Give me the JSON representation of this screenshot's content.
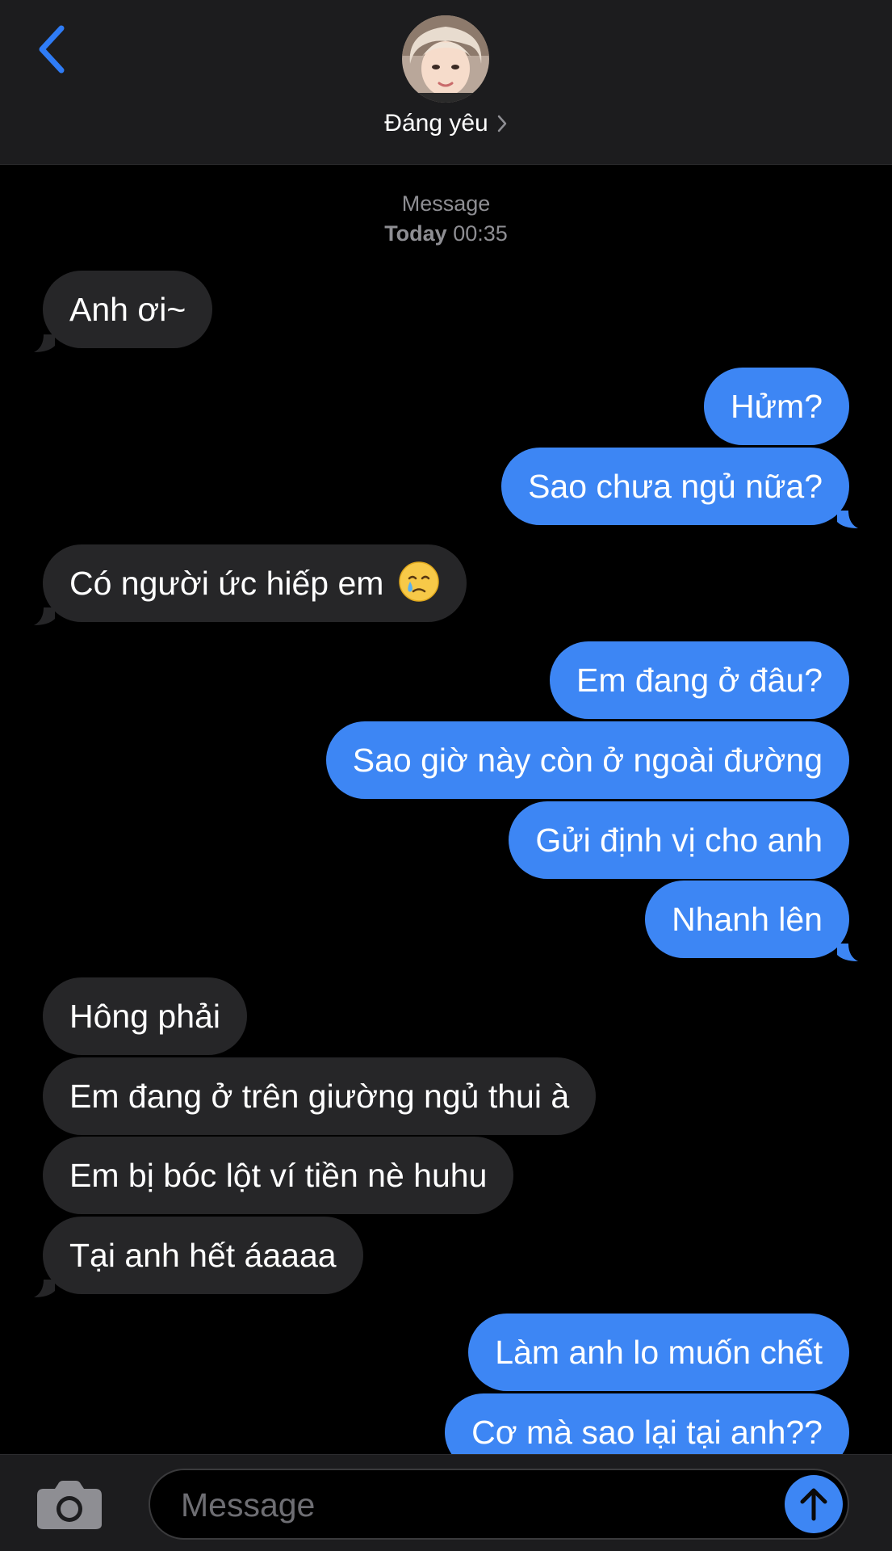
{
  "header": {
    "contact_name": "Đáng yêu"
  },
  "timestamp": {
    "service": "Message",
    "day": "Today",
    "time": "00:35"
  },
  "messages": [
    {
      "from": "them",
      "text": "Anh ơi~"
    },
    {
      "from": "me",
      "text": "Hửm?"
    },
    {
      "from": "me",
      "text": "Sao chưa ngủ nữa?"
    },
    {
      "from": "them",
      "text": "Có người ức hiếp em",
      "emoji": "crying-face"
    },
    {
      "from": "me",
      "text": "Em đang ở đâu?"
    },
    {
      "from": "me",
      "text": "Sao giờ này còn ở ngoài đường"
    },
    {
      "from": "me",
      "text": "Gửi định vị cho anh"
    },
    {
      "from": "me",
      "text": "Nhanh lên"
    },
    {
      "from": "them",
      "text": "Hông phải"
    },
    {
      "from": "them",
      "text": "Em đang ở trên giường ngủ thui à"
    },
    {
      "from": "them",
      "text": "Em bị bóc lột ví tiền nè huhu"
    },
    {
      "from": "them",
      "text": "Tại anh hết áaaaa"
    },
    {
      "from": "me",
      "text": "Làm anh lo muốn chết"
    },
    {
      "from": "me",
      "text": "Cơ mà sao lại tại anh??"
    }
  ],
  "input": {
    "placeholder": "Message"
  },
  "colors": {
    "accent": "#3d86f4",
    "incoming_bubble": "#262628",
    "header_bg": "#1c1c1e"
  },
  "icons": {
    "back": "chevron-left-icon",
    "name_chevron": "chevron-right-icon",
    "camera": "camera-icon",
    "send": "arrow-up-icon"
  }
}
